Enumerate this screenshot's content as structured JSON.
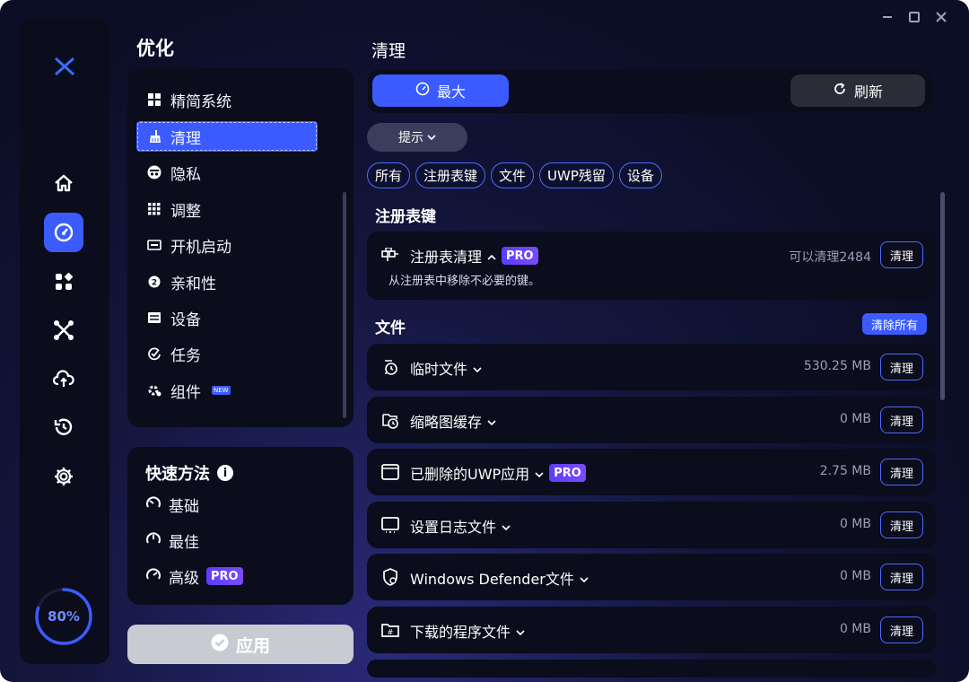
{
  "window": {
    "controls": [
      "minimize",
      "maximize",
      "close"
    ]
  },
  "rail": {
    "icons": [
      "logo-icon",
      "home-icon",
      "gauge-icon",
      "apps-icon",
      "tools-icon",
      "cloud-upload-icon",
      "history-icon",
      "gear-icon"
    ],
    "active": "gauge-icon",
    "progress_label": "80%",
    "progress_value": 0.8,
    "accent": "#3b5bff"
  },
  "optimize": {
    "title": "优化",
    "menu": [
      {
        "label": "精简系统",
        "icon": "windows-icon"
      },
      {
        "label": "清理",
        "icon": "broom-icon",
        "active": true
      },
      {
        "label": "隐私",
        "icon": "privacy-icon"
      },
      {
        "label": "调整",
        "icon": "grid-icon"
      },
      {
        "label": "开机启动",
        "icon": "startup-icon"
      },
      {
        "label": "亲和性",
        "icon": "cpu-icon"
      },
      {
        "label": "设备",
        "icon": "device-icon"
      },
      {
        "label": "任务",
        "icon": "task-icon"
      },
      {
        "label": "组件",
        "icon": "component-icon",
        "badge": "NEW"
      }
    ]
  },
  "quick": {
    "title": "快速方法",
    "items": [
      {
        "label": "基础",
        "icon": "speed-low-icon"
      },
      {
        "label": "最佳",
        "icon": "speed-mid-icon"
      },
      {
        "label": "高级",
        "icon": "speed-high-icon",
        "badge": "PRO"
      }
    ]
  },
  "apply_label": "应用",
  "clean": {
    "title": "清理",
    "mode_max": "最大",
    "mode_refresh": "刷新",
    "hint": "提示",
    "filters": [
      "所有",
      "注册表键",
      "文件",
      "UWP残留",
      "设备"
    ],
    "registry_section": "注册表键",
    "registry_row": {
      "name": "注册表清理",
      "badge": "PRO",
      "desc": "从注册表中移除不必要的键。",
      "size": "可以清理2484",
      "button": "清理"
    },
    "files_section": "文件",
    "clear_all": "清除所有",
    "files": [
      {
        "name": "临时文件",
        "size": "530.25 MB",
        "button": "清理",
        "icon": "temp-file-icon"
      },
      {
        "name": "缩略图缓存",
        "size": "0 MB",
        "button": "清理",
        "icon": "thumbnail-cache-icon"
      },
      {
        "name": "已删除的UWP应用",
        "size": "2.75 MB",
        "button": "清理",
        "icon": "uwp-app-icon",
        "badge": "PRO"
      },
      {
        "name": "设置日志文件",
        "size": "0 MB",
        "button": "清理",
        "icon": "log-file-icon"
      },
      {
        "name": "Windows Defender文件",
        "size": "0 MB",
        "button": "清理",
        "icon": "defender-icon"
      },
      {
        "name": "下载的程序文件",
        "size": "0 MB",
        "button": "清理",
        "icon": "download-folder-icon"
      }
    ]
  }
}
